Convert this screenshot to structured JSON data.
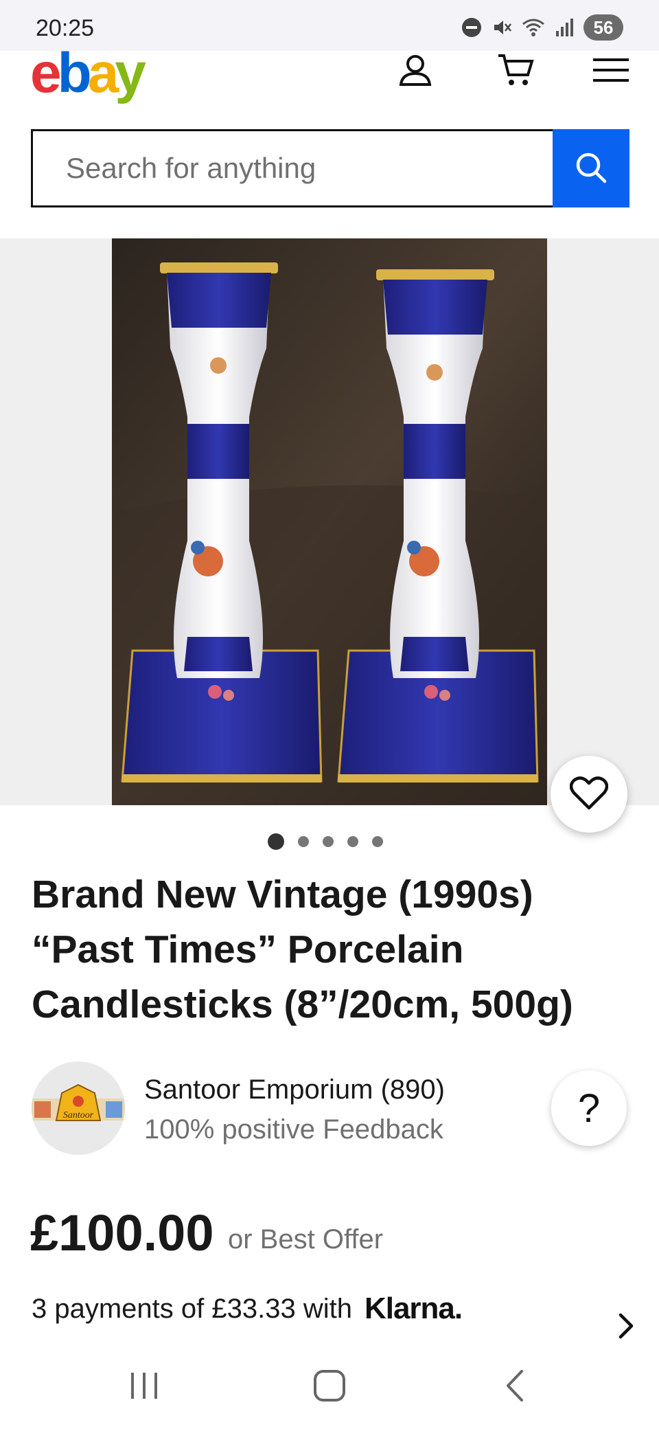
{
  "status_bar": {
    "time": "20:25",
    "battery": "56",
    "icons": [
      "do-not-disturb-icon",
      "mute-icon",
      "wifi-icon",
      "signal-icon"
    ]
  },
  "header": {
    "logo_letters": [
      "e",
      "b",
      "a",
      "y"
    ],
    "icons": [
      "account-icon",
      "cart-icon",
      "menu-icon"
    ]
  },
  "search": {
    "placeholder": "Search for anything"
  },
  "gallery": {
    "image_count": 5,
    "active_index": 0
  },
  "listing": {
    "title_lines": [
      "Brand New Vintage (1990s)",
      "“Past Times” Porcelain",
      "Candlesticks (8”/20cm, 500g)"
    ]
  },
  "seller": {
    "name": "Santoor Emporium (890)",
    "feedback": "100% positive Feedback",
    "logo_text": "Santoor"
  },
  "price": {
    "amount": "£100.00",
    "offer": "or Best Offer",
    "installments": "3 payments of £33.33 with",
    "provider": "Klarna."
  },
  "colors": {
    "ebay_red": "#e53238",
    "ebay_blue": "#0064d2",
    "ebay_yellow": "#f5af02",
    "ebay_green": "#86b817",
    "search_button": "#0a63f0",
    "muted_text": "#707070"
  }
}
